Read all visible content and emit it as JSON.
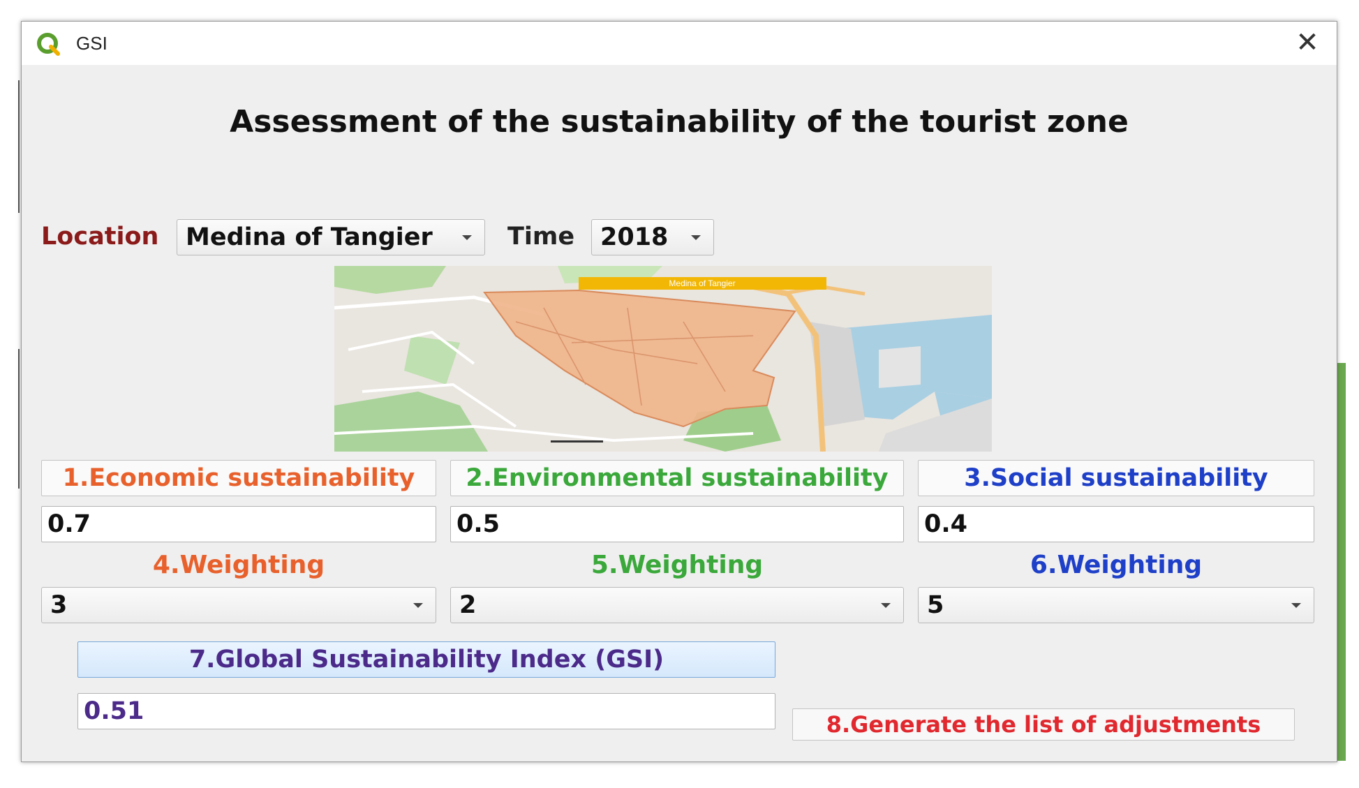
{
  "window": {
    "title": "GSI",
    "icon": "qgis-icon",
    "close_icon": "close-icon",
    "close_glyph": "✕"
  },
  "heading": "Assessment of the sustainability of the tourist zone",
  "filters": {
    "location_label": "Location",
    "location_value": "Medina of Tangier",
    "time_label": "Time",
    "time_value": "2018"
  },
  "map": {
    "banner": "Medina of Tangier"
  },
  "indicators": [
    {
      "label": "1.Economic sustainability",
      "value": "0.7",
      "weighting_label": "4.Weighting",
      "weighting_value": "3",
      "color": "#e8612c"
    },
    {
      "label": "2.Environmental sustainability",
      "value": "0.5",
      "weighting_label": "5.Weighting",
      "weighting_value": "2",
      "color": "#3aa83a"
    },
    {
      "label": "3.Social sustainability",
      "value": "0.4",
      "weighting_label": "6.Weighting",
      "weighting_value": "5",
      "color": "#1e3fc8"
    }
  ],
  "gsi": {
    "button_label": "7.Global Sustainability Index (GSI)",
    "value": "0.51",
    "color": "#4b2a8a"
  },
  "generate_button": {
    "label": "8.Generate the list of adjustments",
    "color": "#e0282e"
  },
  "colors": {
    "location_label": "#8b1a1a",
    "time_label": "#222222",
    "zone_fill": "#f0b48a"
  }
}
